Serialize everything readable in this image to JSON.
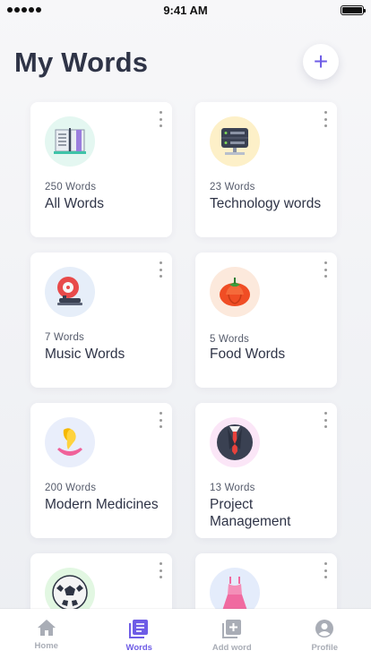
{
  "status_bar": {
    "time": "9:41 AM"
  },
  "header": {
    "title": "My Words",
    "add_label": "+"
  },
  "categories": [
    {
      "count": "250 Words",
      "name": "All Words",
      "icon": "book-icon",
      "bg": "#e4f7f1"
    },
    {
      "count": "23 Words",
      "name": "Technology words",
      "icon": "server-icon",
      "bg": "#fdf0c8"
    },
    {
      "count": "7 Words",
      "name": "Music Words",
      "icon": "gramophone-icon",
      "bg": "#e6eef9"
    },
    {
      "count": "5 Words",
      "name": "Food Words",
      "icon": "tomato-icon",
      "bg": "#fce9dc"
    },
    {
      "count": "200 Words",
      "name": "Modern Medicines",
      "icon": "tooth-icon",
      "bg": "#e9eefb"
    },
    {
      "count": "13 Words",
      "name": "Project Management",
      "icon": "suit-icon",
      "bg": "#fbe6f7"
    },
    {
      "count": "",
      "name": "",
      "icon": "football-icon",
      "bg": "#e2f7e2"
    },
    {
      "count": "",
      "name": "",
      "icon": "dress-icon",
      "bg": "#e4ecfb"
    }
  ],
  "tab_bar": {
    "accent": "#6e5ce6",
    "inactive": "#a9adb6",
    "tabs": [
      {
        "label": "Home",
        "icon": "home-icon",
        "active": false
      },
      {
        "label": "Words",
        "icon": "words-icon",
        "active": true
      },
      {
        "label": "Add word",
        "icon": "add-word-icon",
        "active": false
      },
      {
        "label": "Profile",
        "icon": "profile-icon",
        "active": false
      }
    ]
  }
}
